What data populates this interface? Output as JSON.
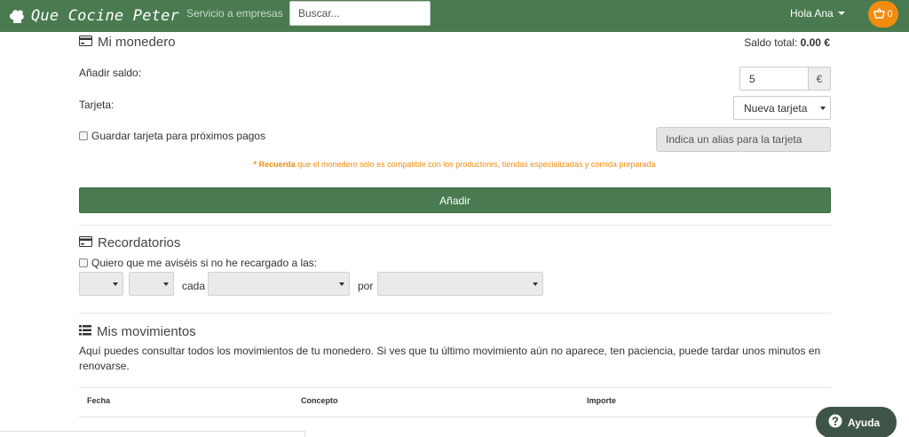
{
  "navbar": {
    "brand": "Que Cocine Peter",
    "business_link": "Servicio a empresas",
    "search_placeholder": "Buscar...",
    "user_greeting": "Hola Ana",
    "cart_count": "0"
  },
  "wallet": {
    "title": "Mi monedero",
    "balance_label": "Saldo total:",
    "balance_value": "0.00 €",
    "add_balance_label": "Añadir saldo:",
    "amount_value": "5",
    "currency": "€",
    "card_label": "Tarjeta:",
    "card_selected": "Nueva tarjeta",
    "save_card_label": "Guardar tarjeta para próximos pagos",
    "alias_placeholder": "Indica un alias para la tarjeta",
    "note_bold": "* Recuerda",
    "note_text": " que el monedero solo es compatible con los productores, tiendas especializadas y comida preparada",
    "add_button": "Añadir"
  },
  "reminders": {
    "title": "Recordatorios",
    "checkbox_label": "Quiero que me aviséis si no he recargado a las:",
    "every_label": "cada",
    "by_label": "por"
  },
  "movements": {
    "title": "Mis movimientos",
    "description": "Aquí puedes consultar todos los movimientos de tu monedero. Si ves que tu último movimiento aún no aparece, ten paciencia, puede tardar unos minutos en renovarse.",
    "columns": [
      "Fecha",
      "Concepto",
      "Importe"
    ]
  },
  "help": {
    "label": "Ayuda"
  },
  "colors": {
    "brand_green": "#4a7a50",
    "accent_orange": "#f28c0f",
    "help_dark": "#3e5447"
  }
}
